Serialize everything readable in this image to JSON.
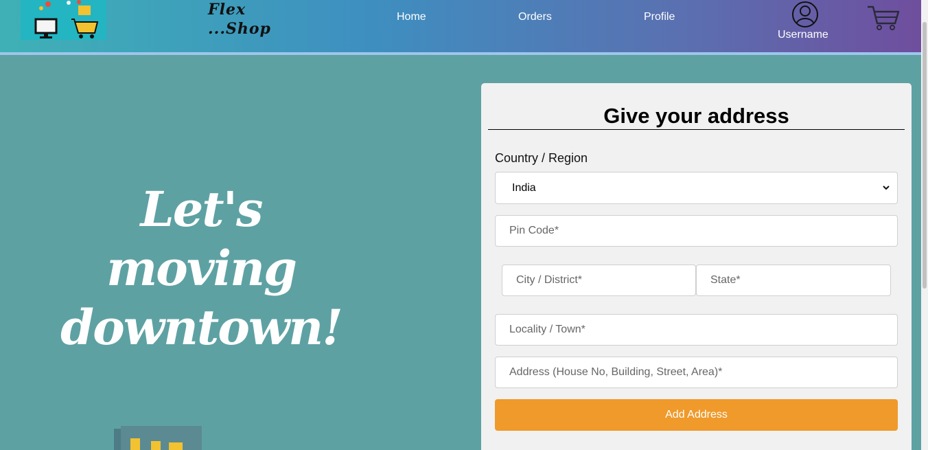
{
  "header": {
    "brand_line1": "Flex",
    "brand_line2": "...Shop",
    "nav": {
      "home": "Home",
      "orders": "Orders",
      "profile": "Profile"
    },
    "username": "Username",
    "icons": {
      "user": "user-circle-icon",
      "cart": "cart-icon"
    }
  },
  "hero": {
    "line1": "Let's moving",
    "line2": "downtown!"
  },
  "form": {
    "title": "Give your address",
    "country_label": "Country / Region",
    "country_value": "India",
    "pin_placeholder": "Pin Code*",
    "city_placeholder": "City / District*",
    "state_placeholder": "State*",
    "locality_placeholder": "Locality / Town*",
    "address_placeholder": "Address (House No, Building, Street, Area)*",
    "submit_label": "Add Address"
  },
  "colors": {
    "page_bg": "#5ea1a3",
    "accent_button": "#ef9a2b",
    "nav_gradient_start": "#3fb1b6",
    "nav_gradient_end": "#6f4e9e"
  }
}
